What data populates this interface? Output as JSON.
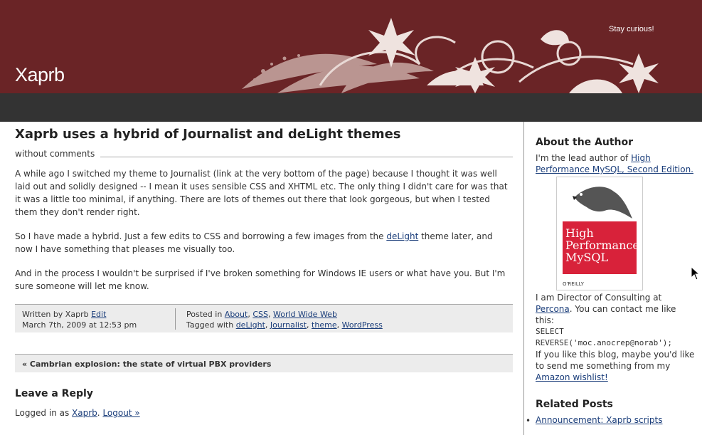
{
  "header": {
    "site_title": "Xaprb",
    "tagline": "Stay curious!"
  },
  "post": {
    "title": "Xaprb uses a hybrid of Journalist and deLight themes",
    "comments": "without comments",
    "p1": "A while ago I switched my theme to Journalist (link at the very bottom of the page) because I thought it was well laid out and solidly designed -- I mean it uses sensible CSS and XHTML etc. The only thing I didn't care for was that it was a little too minimal, if anything. There are lots of themes out there that look gorgeous, but when I tested them they don't render right.",
    "p2_before": "So I have made a hybrid. Just a few edits to CSS and borrowing a few images from the ",
    "p2_link": "deLight",
    "p2_after": " theme later, and now I have something that pleases me visually too.",
    "p3": "And in the process I wouldn't be surprised if I've broken something for Windows IE users or what have you. But I'm sure someone will let me know."
  },
  "postinfo": {
    "written_by": "Written by Xaprb ",
    "edit": "Edit",
    "date": "March 7th, 2009 at 12:53 pm",
    "posted_in": "Posted in ",
    "categories": [
      "About",
      "CSS",
      "World Wide Web"
    ],
    "tagged_with": "Tagged with ",
    "tags": [
      "deLight",
      "Journalist",
      "theme",
      "WordPress"
    ]
  },
  "prev_post": "« Cambrian explosion: the state of virtual PBX providers",
  "reply": {
    "title": "Leave a Reply",
    "logged_in_as": "Logged in as ",
    "user": "Xaprb",
    "logout": "Logout »"
  },
  "sidebar": {
    "about_title": "About the Author",
    "about_intro": "I'm the lead author of ",
    "book_link": "High Performance MySQL, Second Edition.",
    "book_cover_title": "High Performance MySQL",
    "book_publisher": "O'REILLY",
    "director_text": "I am Director of Consulting at ",
    "percona": "Percona",
    "contact_text": ". You can contact me like this:",
    "sql_line1": "SELECT",
    "sql_line2": "REVERSE('moc.anocrep@norab');",
    "wish_text": "If you like this blog, maybe you'd like to send me something from my ",
    "wishlist": "Amazon wishlist!",
    "related_title": "Related Posts",
    "related_item": "Announcement: Xaprb scripts"
  },
  "colors": {
    "header_bg": "#6a2426",
    "nav_bg": "#333333",
    "link": "#1a3d7a"
  }
}
